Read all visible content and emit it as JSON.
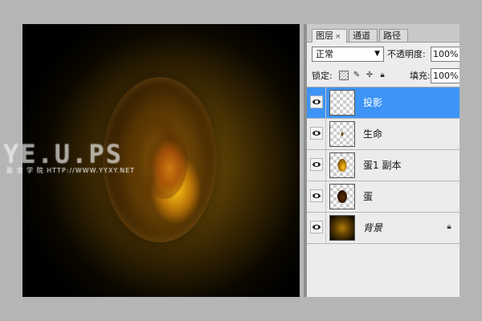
{
  "watermark": {
    "title": "YE.U.PS",
    "subtitle": "盈 余 学 院   HTTP://WWW.YYXY.NET"
  },
  "panel": {
    "tabs": [
      {
        "label": "图层",
        "active": true,
        "close": "×"
      },
      {
        "label": "通道",
        "active": false
      },
      {
        "label": "路径",
        "active": false
      }
    ],
    "blend_mode": "正常",
    "blend_arrow": "▼",
    "opacity_label": "不透明度:",
    "opacity_value": "100%",
    "lock_label": "锁定:",
    "lock_icons": [
      "lock-transparent-icon",
      "brush-icon",
      "move-icon",
      "padlock-icon"
    ],
    "fill_label": "填充:",
    "fill_value": "100%",
    "layers": [
      {
        "name": "投影",
        "selected": true,
        "thumb": "transparent"
      },
      {
        "name": "生命",
        "selected": false,
        "thumb": "tiny-mark"
      },
      {
        "name": "蛋1 副本",
        "selected": false,
        "thumb": "gold-egg"
      },
      {
        "name": "蛋",
        "selected": false,
        "thumb": "dark-egg"
      },
      {
        "name": "背景",
        "selected": false,
        "thumb": "background",
        "italic": true,
        "locked": true
      }
    ]
  },
  "colors": {
    "selection": "#3d94f6",
    "panel_bg": "#ececec",
    "page_bg": "#b5b5b5"
  }
}
